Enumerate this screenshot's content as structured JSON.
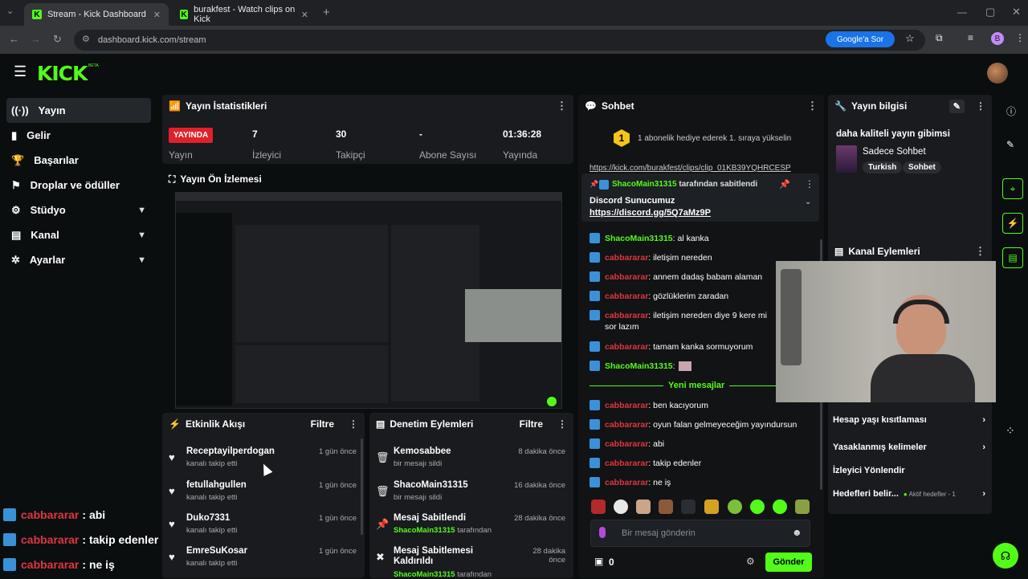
{
  "browser": {
    "tabs": [
      {
        "title": "Stream - Kick Dashboard"
      },
      {
        "title": "burakfest - Watch clips on Kick"
      }
    ],
    "url": "dashboard.kick.com/stream",
    "google_button": "Google'a Sor",
    "profile_initial": "B"
  },
  "header": {
    "logo": "KICK",
    "beta": "BETA"
  },
  "sidebar": {
    "items": [
      {
        "label": "Yayın",
        "icon": "broadcast-icon"
      },
      {
        "label": "Gelir",
        "icon": "revenue-icon"
      },
      {
        "label": "Başarılar",
        "icon": "trophy-icon"
      },
      {
        "label": "Droplar ve ödüller",
        "icon": "gift-icon"
      },
      {
        "label": "Stüdyo",
        "icon": "studio-icon"
      },
      {
        "label": "Kanal",
        "icon": "channel-icon"
      },
      {
        "label": "Ayarlar",
        "icon": "gear-icon"
      }
    ]
  },
  "stats": {
    "title": "Yayın İstatistikleri",
    "live_badge": "YAYINDA",
    "live_label": "Yayın",
    "viewers_value": "7",
    "viewers_label": "İzleyici",
    "followers_value": "30",
    "followers_label": "Takipçi",
    "subs_value": "-",
    "subs_label": "Abone Sayısı",
    "time_value": "01:36:28",
    "time_label": "Yayında"
  },
  "preview": {
    "title": "Yayın Ön İzlemesi"
  },
  "activity": {
    "title": "Etkinlik Akışı",
    "filter": "Filtre",
    "rows": [
      {
        "name": "Receptayilperdogan",
        "sub": "kanalı takip etti",
        "time": "1 gün önce"
      },
      {
        "name": "fetullahgullen",
        "sub": "kanalı takip etti",
        "time": "1 gün önce"
      },
      {
        "name": "Duko7331",
        "sub": "kanalı takip etti",
        "time": "1 gün önce"
      },
      {
        "name": "EmreSuKosar",
        "sub": "kanalı takip etti",
        "time": "1 gün önce"
      }
    ]
  },
  "moderation": {
    "title": "Denetim Eylemleri",
    "filter": "Filtre",
    "rows": [
      {
        "name": "Kemosabbee",
        "sub": "bir mesajı sildi",
        "time": "8 dakika önce",
        "icon": "trash-icon"
      },
      {
        "name": "ShacoMain31315",
        "sub": "bir mesajı sildi",
        "time": "16 dakika önce",
        "icon": "trash-icon"
      },
      {
        "name": "Mesaj Sabitlendi",
        "sub_user": "ShacoMain31315",
        "sub_rest": " tarafından",
        "time": "28 dakika önce",
        "icon": "pin-icon"
      },
      {
        "name": "Mesaj Sabitlemesi Kaldırıldı",
        "sub_user": "ShacoMain31315",
        "sub_rest": " tarafından",
        "time": "28 dakika önce",
        "icon": "unpin-icon"
      }
    ]
  },
  "chat": {
    "title": "Sohbet",
    "gift_banner": "1 abonelik hediye ederek 1. sıraya yükselin",
    "gift_rank": "1",
    "partial_link": "https://kick.com/burakfest/clips/clip_01KB39YQHRCESP",
    "pinned_by_user": "ShacoMain31315",
    "pinned_by_rest": " tarafından sabitlendi",
    "pinned_title": "Discord Sunucumuz",
    "pinned_link": "https://discord.gg/5Q7aMz9P",
    "messages": [
      {
        "user": "ShacoMain31315",
        "color": "green",
        "text": ": al kanka"
      },
      {
        "user": "cabbararar",
        "color": "red",
        "text": ": iletişim nereden"
      },
      {
        "user": "cabbararar",
        "color": "red",
        "text": ": annem dadaş babam alaman"
      },
      {
        "user": "cabbararar",
        "color": "red",
        "text": ": gözlüklerim zaradan"
      },
      {
        "user": "cabbararar",
        "color": "red",
        "text": ": iletişim nereden diye 9 kere mi sor lazım"
      },
      {
        "user": "cabbararar",
        "color": "red",
        "text": ": tamam kanka sormuyorum"
      },
      {
        "user": "ShacoMain31315",
        "color": "green",
        "text": ":"
      }
    ],
    "new_messages_label": "Yeni mesajlar",
    "new_messages": [
      {
        "user": "cabbararar",
        "text": ": ben kacıyorum"
      },
      {
        "user": "cabbararar",
        "text": ": oyun falan gelmeyeceğim yayındursun"
      },
      {
        "user": "cabbararar",
        "text": ": abi"
      },
      {
        "user": "cabbararar",
        "text": ": takip edenler"
      },
      {
        "user": "cabbararar",
        "text": ": ne iş"
      }
    ],
    "input_placeholder": "Bir mesaj gönderin",
    "points": "0",
    "send_label": "Gönder"
  },
  "stream_info": {
    "title": "Yayın bilgisi",
    "stream_title": "daha kaliteli yayın gibimsi",
    "category": "Sadece Sohbet",
    "tags": [
      "Turkish",
      "Sohbet"
    ]
  },
  "channel_actions": {
    "title": "Kanal Eylemleri",
    "items": [
      {
        "label": "Hesap yaşı kısıtlaması"
      },
      {
        "label": "Yasaklanmış kelimeler"
      },
      {
        "label": "İzleyici Yönlendir"
      },
      {
        "label": "Hedefleri belir...",
        "extra": "Aktif hedefler - 1"
      }
    ]
  },
  "overlay_chat": [
    {
      "user": "cabbararar",
      "text": ": abi"
    },
    {
      "user": "cabbararar",
      "text": ": takip edenler"
    },
    {
      "user": "cabbararar",
      "text": ": ne iş"
    }
  ],
  "colors": {
    "accent": "#53fc18",
    "live": "#e0212a",
    "username_red": "#e0363f",
    "badge": "#3b91d8"
  }
}
